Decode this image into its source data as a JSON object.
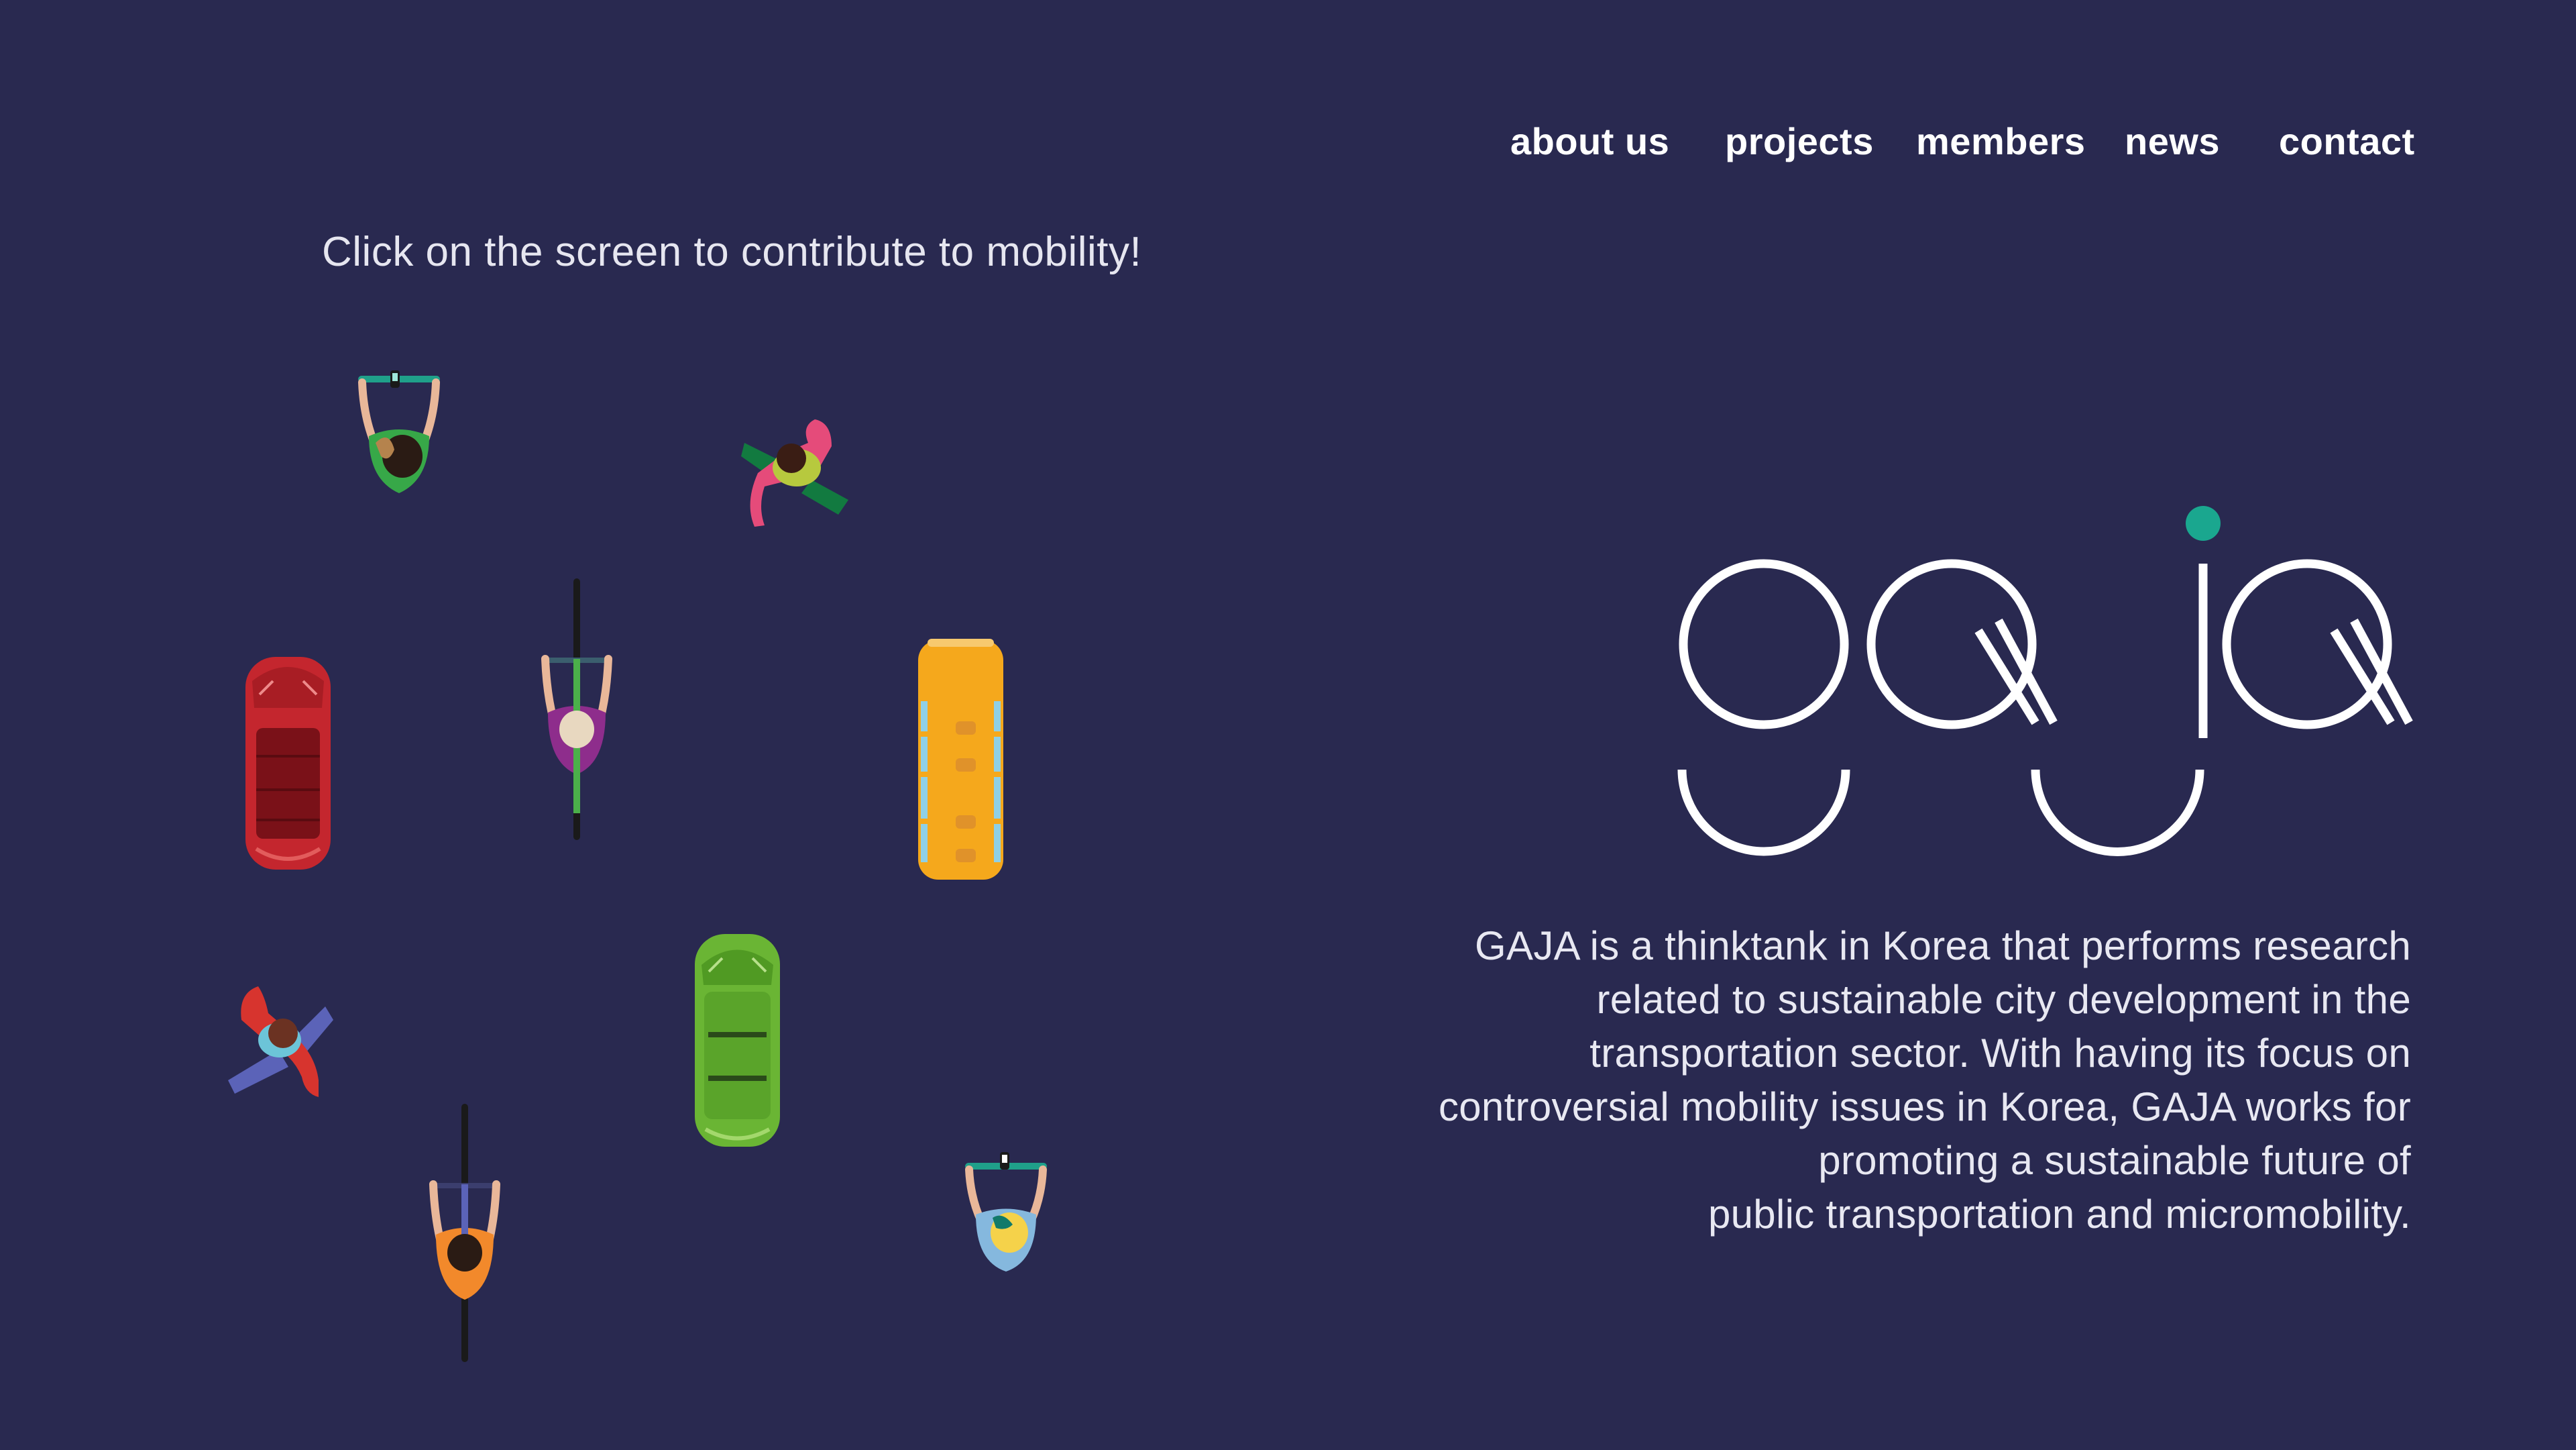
{
  "nav": {
    "about_label": "about us",
    "projects_label": "projects",
    "members_label": "members",
    "news_label": "news",
    "contact_label": "contact"
  },
  "hint": "Click on the screen to contribute to mobility!",
  "logo": {
    "text": "gaja",
    "accent_color": "#1aa78f"
  },
  "description": {
    "lines": [
      "GAJA is a thinktank in Korea that performs research",
      "related to sustainable city development in the",
      "transportation sector. With having its focus on",
      "controversial mobility issues in Korea, GAJA works for",
      "promoting a sustainable future of",
      "public transportation and micromobility."
    ]
  },
  "colors": {
    "background": "#292950",
    "text": "#ffffff",
    "accent": "#1aa78f",
    "red_car": "#c4262e",
    "green_car": "#6ab534",
    "bus": "#f5a81c"
  },
  "actors": [
    {
      "type": "scooter-rider",
      "shirt": "#37a848",
      "hair": "#2a1b14"
    },
    {
      "type": "pedestrian",
      "shirt": "#e54b7a",
      "accent": "#127a40"
    },
    {
      "type": "car",
      "color": "#c4262e"
    },
    {
      "type": "cyclist",
      "shirt": "#8e2d8c",
      "hair": "#e8d8c0"
    },
    {
      "type": "bus",
      "color": "#f5a81c"
    },
    {
      "type": "pedestrian",
      "shirt": "#d7342e",
      "accent": "#5b63b8"
    },
    {
      "type": "car",
      "color": "#6ab534"
    },
    {
      "type": "cyclist",
      "shirt": "#f2892b",
      "hair": "#2a1b14"
    },
    {
      "type": "scooter-rider",
      "shirt": "#85b8de",
      "hair": "#f5d24a"
    }
  ]
}
